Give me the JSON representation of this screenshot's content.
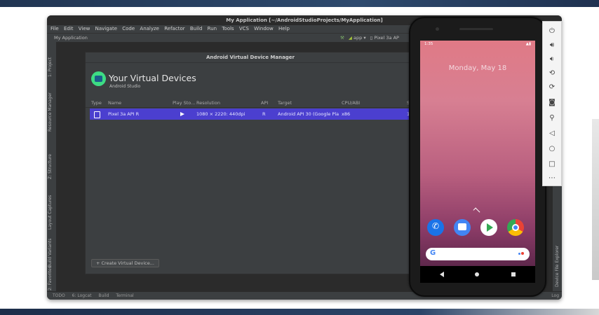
{
  "window": {
    "title": "My Application [~/AndroidStudioProjects/MyApplication]"
  },
  "menu": [
    "File",
    "Edit",
    "View",
    "Navigate",
    "Code",
    "Analyze",
    "Refactor",
    "Build",
    "Run",
    "Tools",
    "VCS",
    "Window",
    "Help"
  ],
  "breadcrumb": {
    "project": "My Application",
    "run_config": "app",
    "device": "Pixel 3a AP"
  },
  "left_tools": [
    "1: Project",
    "Resource Manager",
    "Z: Structure",
    "Layout Captures",
    "Build Variants",
    "2: Favorites"
  ],
  "right_tools": [
    "Device File Explorer"
  ],
  "status_tabs": [
    "TODO",
    "6: Logcat",
    "Build",
    "Terminal"
  ],
  "status_right": "Log",
  "avd": {
    "window_title": "Android Virtual Device Manager",
    "heading": "Your Virtual Devices",
    "subheading": "Android Studio",
    "columns": [
      "Type",
      "Name",
      "Play Sto...",
      "Resolution",
      "API",
      "Target",
      "CPU/ABI",
      "S"
    ],
    "device": {
      "name": "Pixel 3a API R",
      "resolution": "1080 × 2220: 440dpi",
      "api": "R",
      "target": "Android API 30 (Google Pla",
      "cpu": "x86",
      "size": "1"
    },
    "create_button": "+ Create Virtual Device..."
  },
  "phone": {
    "status_time": "1:35",
    "date": "Monday, May 18",
    "search_placeholder": "G"
  },
  "colors": {
    "selected_row": "#4b3fcf",
    "ide_dark": "#3c3f41",
    "android_green": "#3ddc84"
  },
  "emulator_controls": [
    "power-icon",
    "volume-up-icon",
    "volume-down-icon",
    "rotate-left-icon",
    "rotate-right-icon",
    "camera-icon",
    "zoom-icon",
    "back-icon",
    "home-icon",
    "overview-icon",
    "more-icon"
  ]
}
